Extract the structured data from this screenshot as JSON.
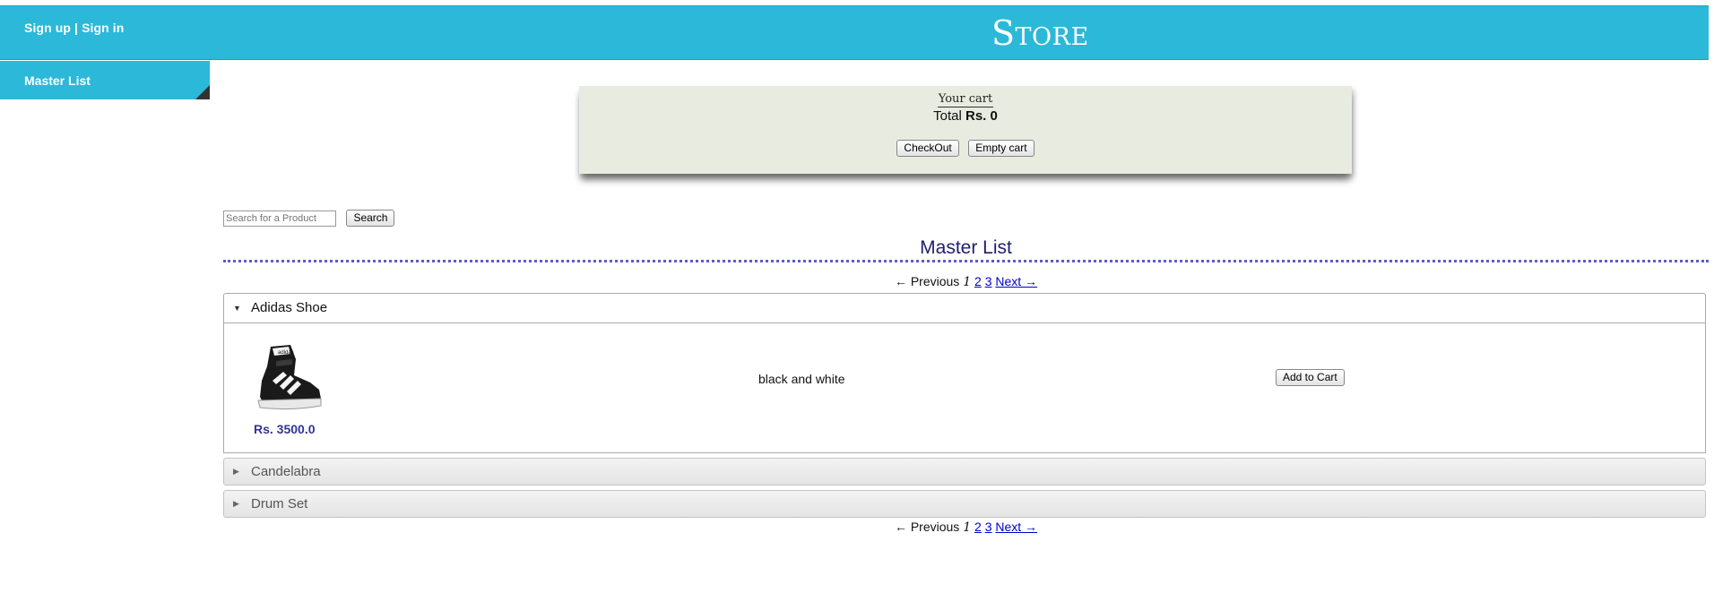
{
  "header": {
    "signup": "Sign up",
    "separator": "|",
    "signin": "Sign in",
    "title": "Store"
  },
  "sidebar": {
    "items": [
      {
        "label": "Master List"
      }
    ]
  },
  "cart": {
    "title": "Your cart",
    "total_label": "Total",
    "total_value": "Rs. 0",
    "checkout_label": "CheckOut",
    "empty_label": "Empty cart"
  },
  "search": {
    "placeholder": "Search for a Product",
    "button_label": "Search"
  },
  "section": {
    "title": "Master List"
  },
  "pagination": {
    "prev": "← Previous",
    "current": "1",
    "pages": [
      "2",
      "3"
    ],
    "next": "Next →"
  },
  "products": [
    {
      "name": "Adidas Shoe",
      "expanded": true,
      "price": "Rs. 3500.0",
      "description": "black and white",
      "add_label": "Add to Cart",
      "image_icon": "sneaker-image"
    },
    {
      "name": "Candelabra",
      "expanded": false
    },
    {
      "name": "Drum Set",
      "expanded": false
    }
  ],
  "colors": {
    "header_bg": "#2cb8d8",
    "cart_bg": "#e8ebdf",
    "price": "#343497",
    "link": "#0000cc",
    "heading": "#1e1e6e"
  }
}
